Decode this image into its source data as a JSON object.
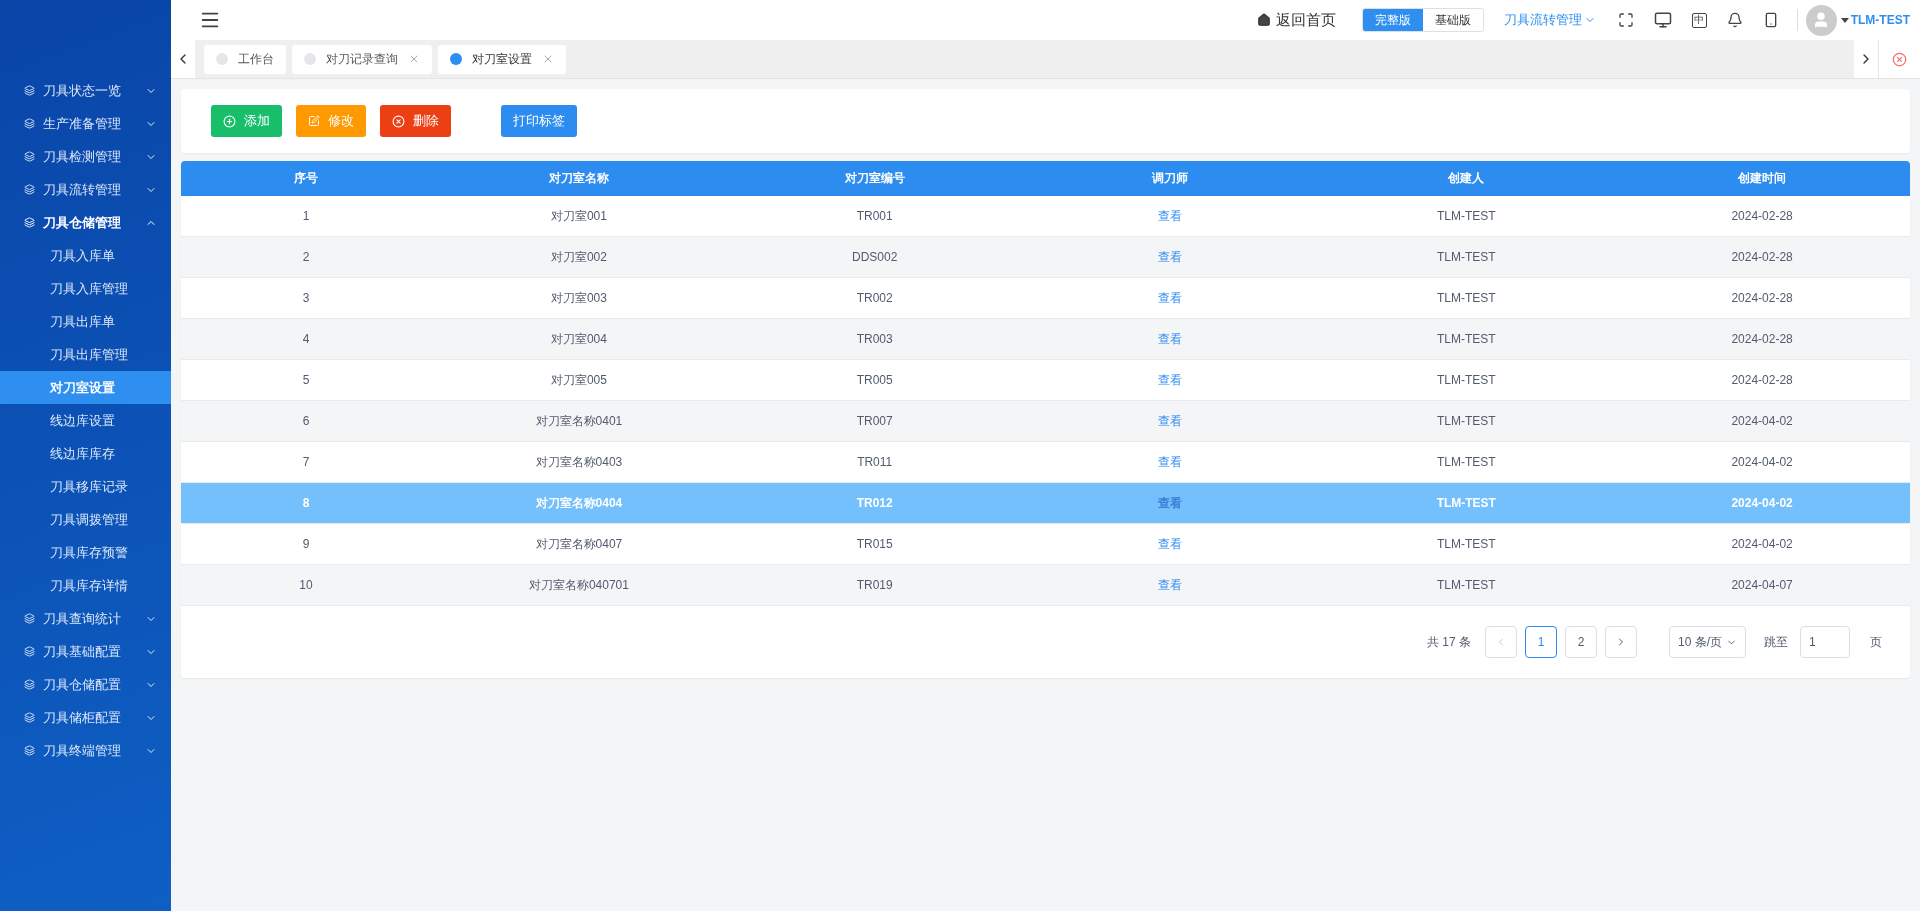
{
  "sidebar": {
    "groups": [
      {
        "label": "刀具状态一览",
        "expanded": false
      },
      {
        "label": "生产准备管理",
        "expanded": false
      },
      {
        "label": "刀具检测管理",
        "expanded": false
      },
      {
        "label": "刀具流转管理",
        "expanded": false
      },
      {
        "label": "刀具仓储管理",
        "expanded": true,
        "children": [
          {
            "label": "刀具入库单",
            "selected": false
          },
          {
            "label": "刀具入库管理",
            "selected": false
          },
          {
            "label": "刀具出库单",
            "selected": false
          },
          {
            "label": "刀具出库管理",
            "selected": false
          },
          {
            "label": "对刀室设置",
            "selected": true
          },
          {
            "label": "线边库设置",
            "selected": false
          },
          {
            "label": "线边库库存",
            "selected": false
          },
          {
            "label": "刀具移库记录",
            "selected": false
          },
          {
            "label": "刀具调拨管理",
            "selected": false
          },
          {
            "label": "刀具库存预警",
            "selected": false
          },
          {
            "label": "刀具库存详情",
            "selected": false
          }
        ]
      },
      {
        "label": "刀具查询统计",
        "expanded": false
      },
      {
        "label": "刀具基础配置",
        "expanded": false
      },
      {
        "label": "刀具仓储配置",
        "expanded": false
      },
      {
        "label": "刀具储柜配置",
        "expanded": false
      },
      {
        "label": "刀具终端管理",
        "expanded": false
      }
    ]
  },
  "header": {
    "home": "返回首页",
    "versions": [
      {
        "label": "完整版",
        "selected": true
      },
      {
        "label": "基础版",
        "selected": false
      }
    ],
    "module": "刀具流转管理",
    "lang": "中",
    "user": "TLM-TEST"
  },
  "tabs": [
    {
      "label": "工作台",
      "selected": false,
      "closable": false
    },
    {
      "label": "对刀记录查询",
      "selected": false,
      "closable": true
    },
    {
      "label": "对刀室设置",
      "selected": true,
      "closable": true
    }
  ],
  "toolbar": [
    {
      "label": "添加",
      "kind": "add"
    },
    {
      "label": "修改",
      "kind": "edit"
    },
    {
      "label": "删除",
      "kind": "delete"
    },
    {
      "label": "打印标签",
      "kind": "print"
    }
  ],
  "table": {
    "columns": [
      "序号",
      "对刀室名称",
      "对刀室编号",
      "调刀师",
      "创建人",
      "创建时间"
    ],
    "rows": [
      {
        "cells": [
          "1",
          "对刀室001",
          "TR001",
          "查看",
          "TLM-TEST",
          "2024-02-28"
        ],
        "selected": false
      },
      {
        "cells": [
          "2",
          "对刀室002",
          "DDS002",
          "查看",
          "TLM-TEST",
          "2024-02-28"
        ],
        "selected": false
      },
      {
        "cells": [
          "3",
          "对刀室003",
          "TR002",
          "查看",
          "TLM-TEST",
          "2024-02-28"
        ],
        "selected": false
      },
      {
        "cells": [
          "4",
          "对刀室004",
          "TR003",
          "查看",
          "TLM-TEST",
          "2024-02-28"
        ],
        "selected": false
      },
      {
        "cells": [
          "5",
          "对刀室005",
          "TR005",
          "查看",
          "TLM-TEST",
          "2024-02-28"
        ],
        "selected": false
      },
      {
        "cells": [
          "6",
          "对刀室名称0401",
          "TR007",
          "查看",
          "TLM-TEST",
          "2024-04-02"
        ],
        "selected": false
      },
      {
        "cells": [
          "7",
          "对刀室名称0403",
          "TR011",
          "查看",
          "TLM-TEST",
          "2024-04-02"
        ],
        "selected": false
      },
      {
        "cells": [
          "8",
          "对刀室名称0404",
          "TR012",
          "查看",
          "TLM-TEST",
          "2024-04-02"
        ],
        "selected": true
      },
      {
        "cells": [
          "9",
          "对刀室名称0407",
          "TR015",
          "查看",
          "TLM-TEST",
          "2024-04-02"
        ],
        "selected": false
      },
      {
        "cells": [
          "10",
          "对刀室名称040701",
          "TR019",
          "查看",
          "TLM-TEST",
          "2024-04-07"
        ],
        "selected": false
      }
    ]
  },
  "pagination": {
    "total": "共 17 条",
    "pages": [
      {
        "label": "1",
        "selected": true
      },
      {
        "label": "2",
        "selected": false
      }
    ],
    "page_size": "10 条/页",
    "jump_label": "跳至",
    "jump_value": "1",
    "page_unit": "页"
  }
}
